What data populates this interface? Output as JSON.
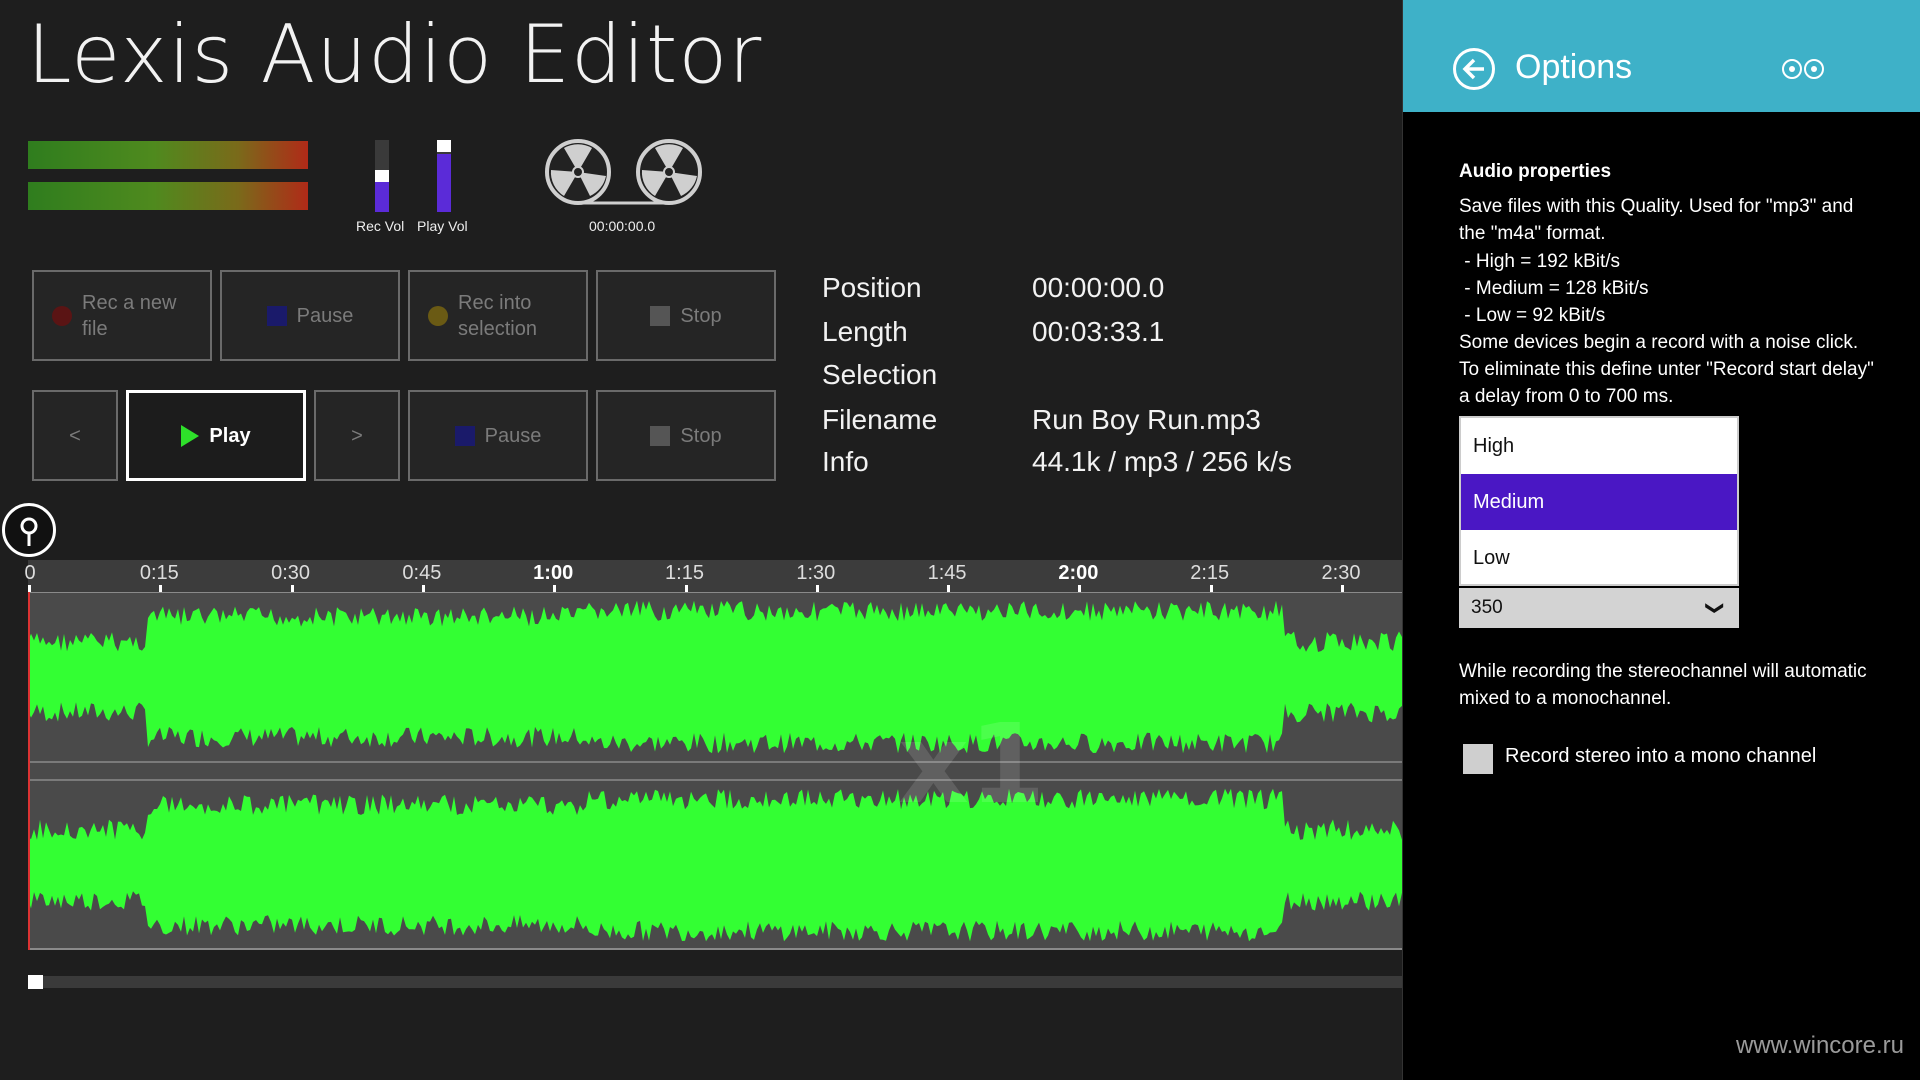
{
  "app": {
    "title": "Lexis Audio Editor",
    "rec_vol_label": "Rec Vol",
    "play_vol_label": "Play Vol",
    "reel_time": "00:00:00.0"
  },
  "record_controls": {
    "rec_new": "Rec a new file",
    "pause": "Pause",
    "rec_into": "Rec into selection",
    "stop": "Stop"
  },
  "play_controls": {
    "prev": "<",
    "play": "Play",
    "next": ">",
    "pause": "Pause",
    "stop": "Stop"
  },
  "info": {
    "position_label": "Position",
    "position_value": "00:00:00.0",
    "length_label": "Length",
    "length_value": "00:03:33.1",
    "selection_label": "Selection",
    "selection_value": "",
    "filename_label": "Filename",
    "filename_value": "Run Boy Run.mp3",
    "info_label": "Info",
    "info_value": "44.1k / mp3 / 256 k/s"
  },
  "timeline": {
    "ticks": [
      "0",
      "0:15",
      "0:30",
      "0:45",
      "1:00",
      "1:15",
      "1:30",
      "1:45",
      "2:00",
      "2:15",
      "2:30"
    ]
  },
  "options": {
    "title": "Options",
    "heading": "Audio properties",
    "quality_desc": "Save files with this Quality. Used for \"mp3\" and the \"m4a\" format.",
    "quality_high": " - High = 192 kBit/s",
    "quality_medium": " - Medium = 128 kBit/s",
    "quality_low": " - Low = 92 kBit/s",
    "delay_desc": "Some devices begin a record with a noise click. To eliminate this define unter \"Record start delay\" a delay from 0 to 700 ms.",
    "quality_options": [
      "High",
      "Medium",
      "Low"
    ],
    "quality_selected": "Medium",
    "delay_value": "350",
    "stereo_desc": "While recording the stereochannel will automatic mixed to a monochannel.",
    "stereo_checkbox_label": "Record stereo into a mono channel"
  },
  "watermark": "www.wincore.ru",
  "colors": {
    "waveform": "#33ff33",
    "header": "#3eb1c8",
    "selection": "#4a17c4",
    "volume": "#5b2bd8"
  }
}
